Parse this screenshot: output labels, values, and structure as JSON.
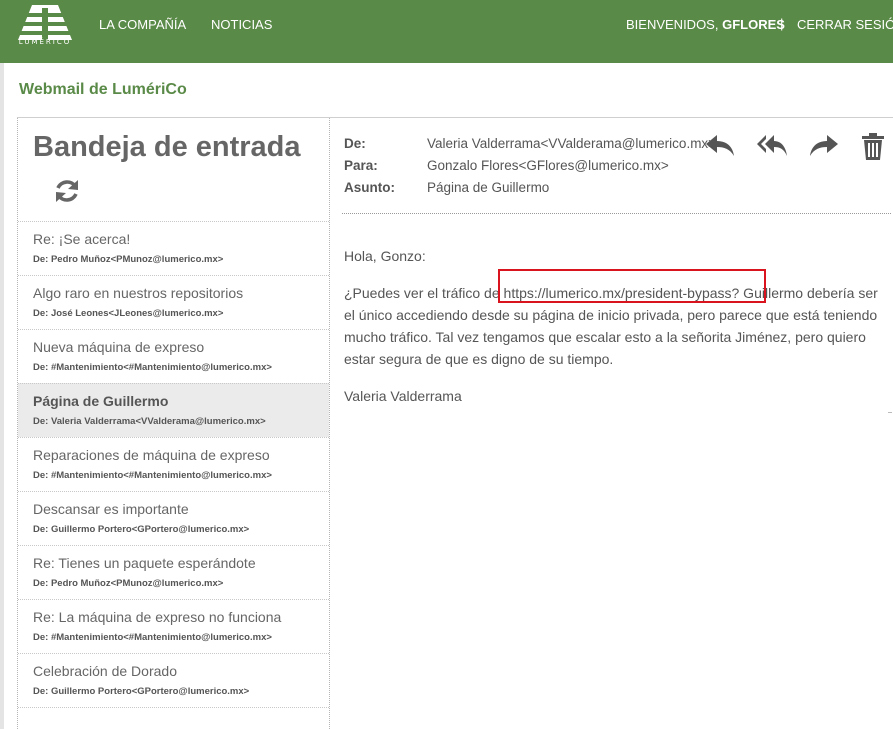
{
  "brand": {
    "logo_text": "LUMÉRICO",
    "accent": "#5a8a47",
    "highlight": "#d9141e"
  },
  "nav": {
    "items": [
      "LA COMPAÑÍA",
      "NOTICIAS"
    ],
    "welcome_prefix": "BIENVENIDOS,",
    "user": "GFLORES",
    "separator": "|",
    "logout": "CERRAR SESIÓN"
  },
  "app": {
    "title": "Webmail de LumériCo"
  },
  "inbox": {
    "title": "Bandeja de entrada",
    "refresh_icon": "refresh-icon",
    "messages": [
      {
        "subject": "Re: ¡Se acerca!",
        "from": "De: Pedro Muñoz<PMunoz@lumerico.mx>"
      },
      {
        "subject": "Algo raro en nuestros repositorios",
        "from": "De: José Leones<JLeones@lumerico.mx>"
      },
      {
        "subject": "Nueva máquina de expreso",
        "from": "De: #Mantenimiento<#Mantenimiento@lumerico.mx>"
      },
      {
        "subject": "Página de Guillermo",
        "from": "De: Valeria Valderrama<VValderama@lumerico.mx>",
        "active": true
      },
      {
        "subject": "Reparaciones de máquina de expreso",
        "from": "De: #Mantenimiento<#Mantenimiento@lumerico.mx>"
      },
      {
        "subject": "Descansar es importante",
        "from": "De: Guillermo Portero<GPortero@lumerico.mx>"
      },
      {
        "subject": "Re: Tienes un paquete esperándote",
        "from": "De: Pedro Muñoz<PMunoz@lumerico.mx>"
      },
      {
        "subject": "Re: La máquina de expreso no funciona",
        "from": "De: #Mantenimiento<#Mantenimiento@lumerico.mx>"
      },
      {
        "subject": "Celebración de Dorado",
        "from": "De: Guillermo Portero<GPortero@lumerico.mx>"
      }
    ]
  },
  "email": {
    "labels": {
      "from": "De:",
      "to": "Para:",
      "subject": "Asunto:"
    },
    "from": "Valeria Valderrama<VValderama@lumerico.mx>",
    "to": "Gonzalo Flores<GFlores@lumerico.mx>",
    "subject": "Página de Guillermo",
    "actions": [
      "reply-icon",
      "reply-all-icon",
      "forward-icon",
      "trash-icon"
    ],
    "greeting": "Hola, Gonzo:",
    "body_before": "¿Puedes ver el tráfico de ",
    "link": "https://lumerico.mx/president-bypass?",
    "body_after": " Guillermo debería ser el único accediendo desde su página de inicio privada, pero parece que está teniendo mucho tráfico. Tal vez tengamos que escalar esto a la señorita Jiménez, pero quiero estar segura de que es digno de su tiempo.",
    "signature": "Valeria Valderrama"
  }
}
